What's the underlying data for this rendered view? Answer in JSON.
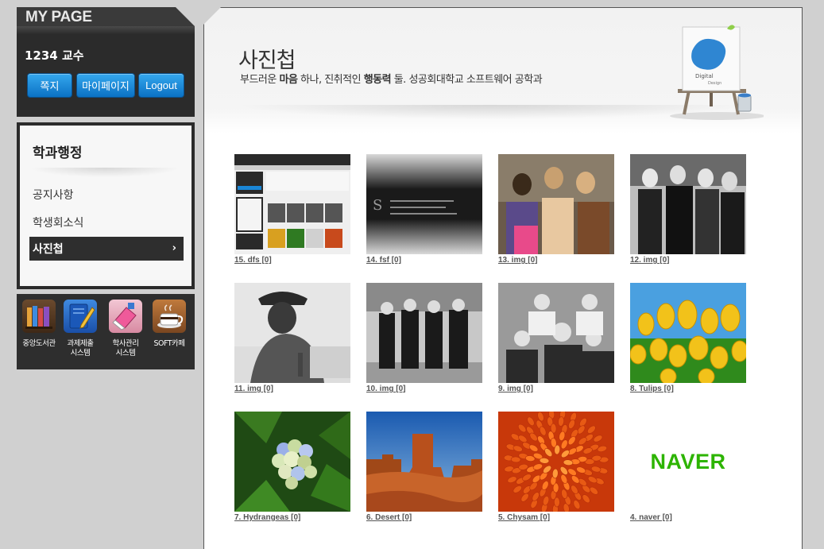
{
  "mypage": {
    "title": "MY PAGE",
    "user": "1234 교수",
    "buttons": {
      "note": "쪽지",
      "mypage": "마이페이지",
      "logout": "Logout"
    }
  },
  "dept": {
    "title": "학과행정",
    "items": [
      {
        "label": "공지사항"
      },
      {
        "label": "학생회소식"
      },
      {
        "label": "사진첩",
        "active": true
      }
    ]
  },
  "quick_links": [
    {
      "label": "중앙도서관",
      "icon": "books-icon"
    },
    {
      "label": "과제제출\n시스템",
      "icon": "notebook-pencil-icon"
    },
    {
      "label": "학사관리\n시스템",
      "icon": "eraser-icon"
    },
    {
      "label": "SOFT카페",
      "icon": "coffee-cup-icon"
    }
  ],
  "header": {
    "title": "사진첩",
    "subtitle_parts": [
      "부드러운 ",
      "마음",
      " 하나, 진취적인 ",
      "행동력",
      " 둘. 성공회대학교 소프트웨어 공학과"
    ],
    "easel_text": [
      "Digital",
      "Design"
    ]
  },
  "gallery": [
    {
      "caption": "15. dfs [0]",
      "kind": "screenshot"
    },
    {
      "caption": "14. fsf [0]",
      "kind": "dark-banner"
    },
    {
      "caption": "13. img [0]",
      "kind": "band-color"
    },
    {
      "caption": "12. img [0]",
      "kind": "band-bw"
    },
    {
      "caption": "11. img [0]",
      "kind": "portrait-bw"
    },
    {
      "caption": "10. img [0]",
      "kind": "band-street"
    },
    {
      "caption": "9. img [0]",
      "kind": "band-group"
    },
    {
      "caption": "8. Tulips [0]",
      "kind": "tulips"
    },
    {
      "caption": "7. Hydrangeas [0]",
      "kind": "hydrangeas"
    },
    {
      "caption": "6. Desert [0]",
      "kind": "desert"
    },
    {
      "caption": "5. Chysam [0]",
      "kind": "chrysanthemum"
    },
    {
      "caption": "4. naver [0]",
      "kind": "naver",
      "logo_text": "NAVER"
    }
  ],
  "colors": {
    "accent_blue": "#1a86d6",
    "dark_panel": "#2b2b2b",
    "naver_green": "#2db400"
  }
}
